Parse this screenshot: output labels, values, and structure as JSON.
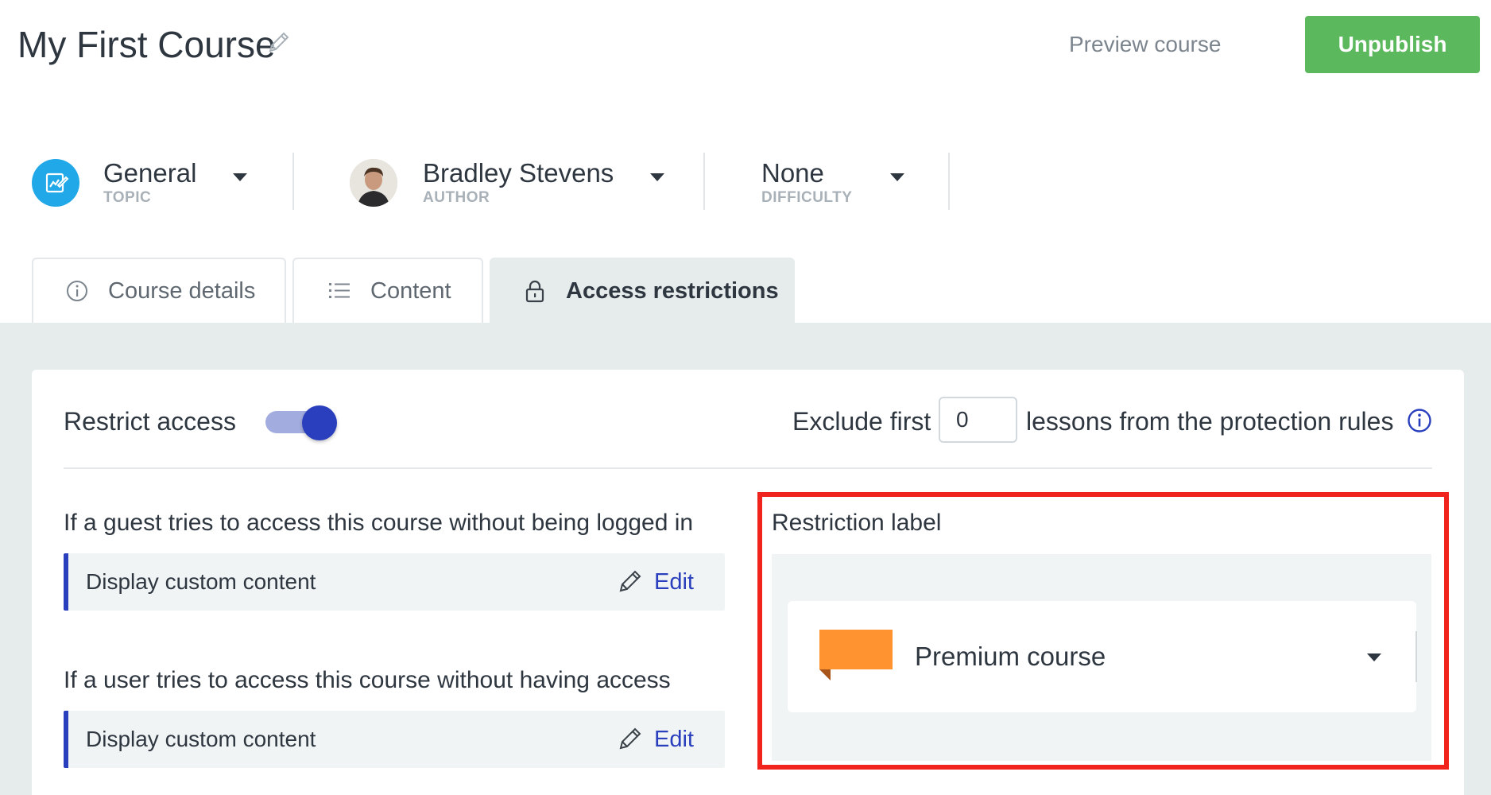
{
  "header": {
    "title": "My First Course",
    "preview_label": "Preview course",
    "publish_label": "Unpublish"
  },
  "meta": {
    "topic": {
      "value": "General",
      "label": "TOPIC",
      "icon": "course-edit-icon"
    },
    "author": {
      "value": "Bradley Stevens",
      "label": "AUTHOR",
      "icon": "author-avatar"
    },
    "difficulty": {
      "value": "None",
      "label": "DIFFICULTY"
    }
  },
  "tabs": [
    {
      "label": "Course details",
      "icon": "info-icon",
      "active": false
    },
    {
      "label": "Content",
      "icon": "list-icon",
      "active": false
    },
    {
      "label": "Access restrictions",
      "icon": "lock-icon",
      "active": true
    }
  ],
  "access": {
    "restrict_label": "Restrict access",
    "restrict_enabled": true,
    "exclude_prefix": "Exclude first",
    "exclude_value": "0",
    "exclude_suffix": "lessons from the protection rules",
    "rules": [
      {
        "title": "If a guest tries to access this course without being logged in",
        "action": "Display custom content",
        "edit_label": "Edit"
      },
      {
        "title": "If a user tries to access this course without having access",
        "action": "Display custom content",
        "edit_label": "Edit"
      }
    ],
    "restriction_label": {
      "title": "Restriction label",
      "selected": "Premium course",
      "flag_color": "#ff9330"
    }
  },
  "colors": {
    "accent": "#2a3fbd",
    "publish": "#5cb85c",
    "highlight": "#f0241c",
    "topic_icon_bg": "#20a8e8"
  }
}
